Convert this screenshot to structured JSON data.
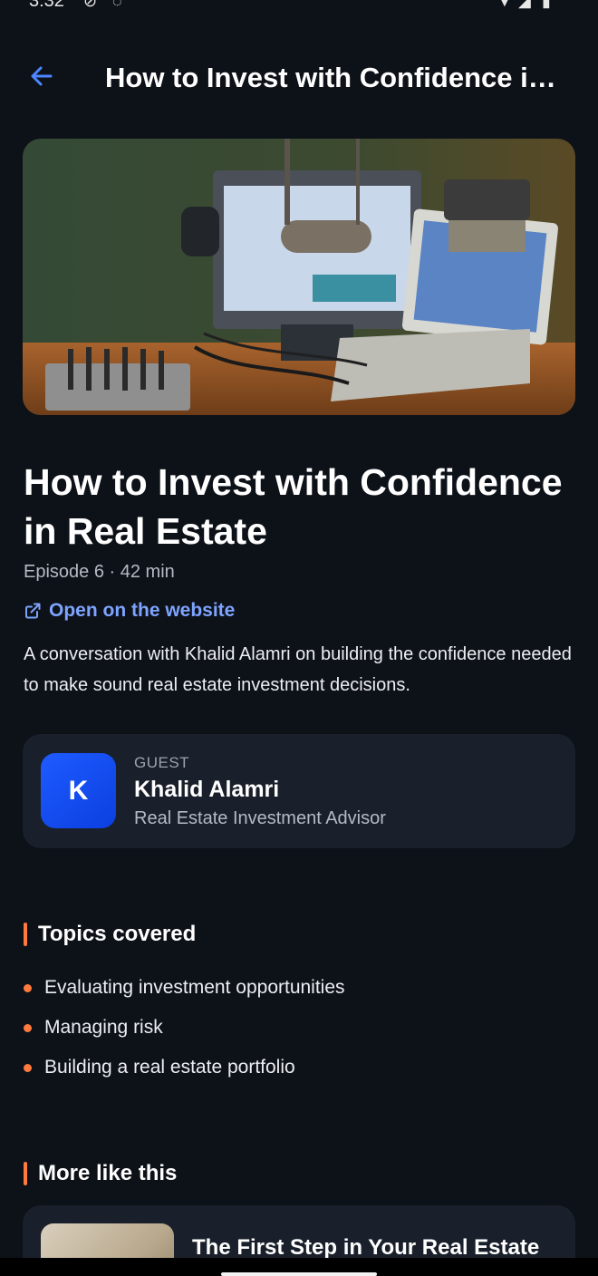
{
  "status_bar": {
    "time": "3:32"
  },
  "app_bar": {
    "title": "How to Invest with Confidence in Real Estate",
    "back_icon": "arrow-left-icon"
  },
  "episode": {
    "title": "How to Invest with Confidence in Real Estate",
    "meta": "Episode 6 · 42 min",
    "open_link": "Open on the website",
    "description": "A conversation with Khalid Alamri on building the confidence needed to make sound real estate investment decisions."
  },
  "guest": {
    "kicker": "GUEST",
    "initial": "K",
    "name": "Khalid Alamri",
    "role": "Real Estate Investment Advisor"
  },
  "topics": {
    "heading": "Topics covered",
    "items": [
      "Evaluating investment opportunities",
      "Managing risk",
      "Building a real estate portfolio"
    ]
  },
  "more": {
    "heading": "More like this",
    "items": [
      {
        "title": "The First Step in Your Real Estate"
      }
    ]
  },
  "colors": {
    "accent": "#ff7a3d",
    "link": "#7ea4ff",
    "background": "#0d1118",
    "card": "#1a202b",
    "avatar": "#1e5bff"
  }
}
